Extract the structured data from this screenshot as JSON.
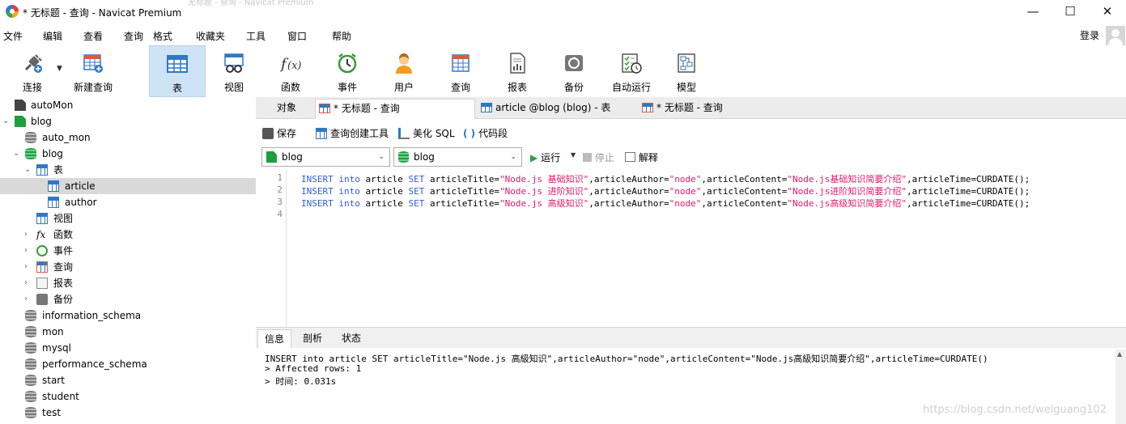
{
  "window": {
    "title": "* 无标题 - 查询 - Navicat Premium",
    "ghost_title": "无标题 - 查询 - Navicat Premium",
    "minimize": "—",
    "maximize": "☐",
    "close": "✕"
  },
  "menubar": {
    "items": [
      "文件",
      "编辑",
      "查看",
      "查询",
      "格式",
      "收藏夹",
      "工具",
      "窗口",
      "帮助"
    ],
    "login": "登录"
  },
  "toolbar": {
    "items": [
      {
        "label": "连接",
        "icon": "plug-icon"
      },
      {
        "label": "新建查询",
        "icon": "new-query-icon"
      },
      {
        "label": "表",
        "icon": "table-icon"
      },
      {
        "label": "视图",
        "icon": "view-icon"
      },
      {
        "label": "函数",
        "icon": "function-icon"
      },
      {
        "label": "事件",
        "icon": "clock-icon"
      },
      {
        "label": "用户",
        "icon": "user-icon"
      },
      {
        "label": "查询",
        "icon": "query-icon"
      },
      {
        "label": "报表",
        "icon": "report-icon"
      },
      {
        "label": "备份",
        "icon": "backup-icon"
      },
      {
        "label": "自动运行",
        "icon": "autorun-icon"
      },
      {
        "label": "模型",
        "icon": "model-icon"
      }
    ],
    "active": "表"
  },
  "tree": {
    "items": [
      {
        "label": "autoMon"
      },
      {
        "label": "blog"
      },
      {
        "label": "auto_mon"
      },
      {
        "label": "blog"
      },
      {
        "label": "表"
      },
      {
        "label": "article",
        "selected": true
      },
      {
        "label": "author"
      },
      {
        "label": "视图"
      },
      {
        "label": "函数"
      },
      {
        "label": "事件"
      },
      {
        "label": "查询"
      },
      {
        "label": "报表"
      },
      {
        "label": "备份"
      },
      {
        "label": "information_schema"
      },
      {
        "label": "mon"
      },
      {
        "label": "mysql"
      },
      {
        "label": "performance_schema"
      },
      {
        "label": "start"
      },
      {
        "label": "student"
      },
      {
        "label": "test"
      }
    ]
  },
  "tabs": {
    "items": [
      "对象",
      "* 无标题 - 查询",
      "article @blog (blog) - 表",
      "* 无标题 - 查询"
    ]
  },
  "editor_toolbar": {
    "save": "保存",
    "builder": "查询创建工具",
    "beautify": "美化 SQL",
    "snippet": "代码段"
  },
  "selectors": {
    "connection": "blog",
    "database": "blog"
  },
  "run": {
    "run": "运行",
    "stop": "停止",
    "explain": "解释"
  },
  "code": {
    "line_numbers": [
      "1",
      "2",
      "3",
      "4"
    ]
  },
  "bottom_tabs": {
    "items": [
      "信息",
      "剖析",
      "状态"
    ]
  },
  "output": {
    "lines": [
      "INSERT into article SET articleTitle=\"Node.js 高級知识\",articleAuthor=\"node\",articleContent=\"Node.js高級知识简要介绍\",articleTime=CURDATE()",
      "> Affected rows: 1",
      "> 时间: 0.031s"
    ]
  },
  "watermark": "https://blog.csdn.net/weiguang102"
}
